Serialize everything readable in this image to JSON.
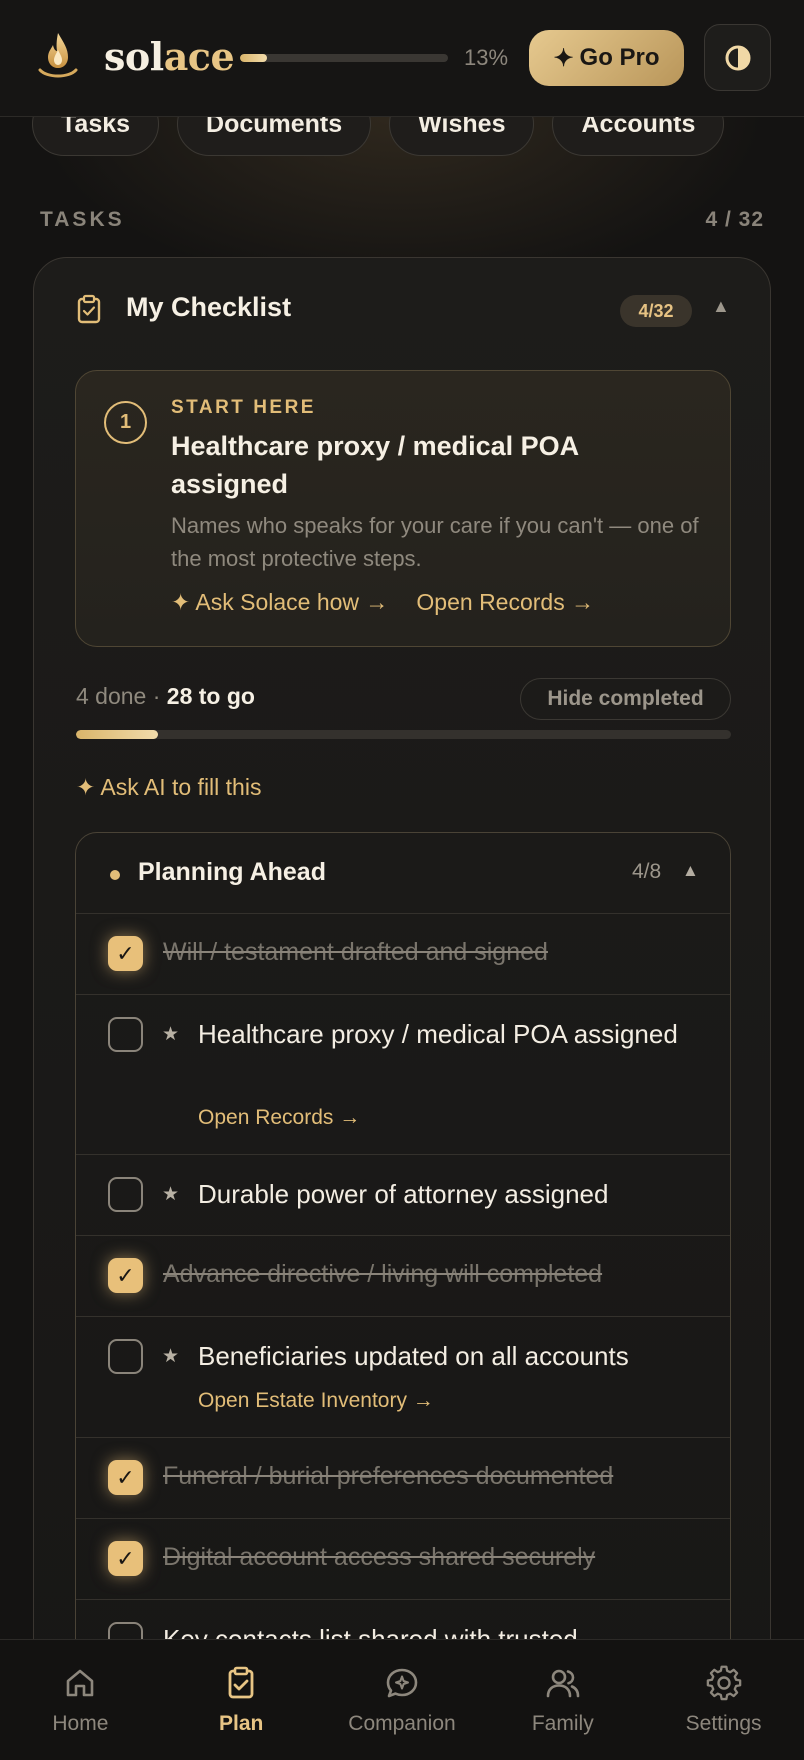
{
  "header": {
    "logo_prefix": "sol",
    "logo_accent": "ace",
    "progress_percent": 13,
    "progress_label": "13%",
    "go_pro_label": "Go Pro",
    "go_pro_icon": "sparkle-icon",
    "theme_icon": "contrast-icon"
  },
  "tabs": [
    {
      "label": "Tasks"
    },
    {
      "label": "Documents"
    },
    {
      "label": "Wishes"
    },
    {
      "label": "Accounts"
    }
  ],
  "section": {
    "label": "TASKS",
    "count": "4 / 32"
  },
  "checklist": {
    "icon": "clipboard-icon",
    "title": "My Checklist",
    "badge": "4/32",
    "start_here": {
      "number": "1",
      "kicker": "START HERE",
      "title": "Healthcare proxy / medical POA assigned",
      "description": "Names who speaks for your care if you can't — one of the most protective steps.",
      "ask_link": "✦ Ask Solace how →",
      "records_link": "Open Records →"
    },
    "progress": {
      "done_text": "4 done · ",
      "to_go_text": "28 to go",
      "done": 4,
      "total": 32
    },
    "hide_completed_label": "Hide completed",
    "ask_ai_label": "✦ Ask AI to fill this",
    "group": {
      "title": "Planning Ahead",
      "count": "4/8",
      "items": [
        {
          "text": "Will / testament drafted and signed",
          "done": true
        },
        {
          "text": "Healthcare proxy / medical POA assigned",
          "done": false,
          "starred": true,
          "link": "Open Records →"
        },
        {
          "text": "Durable power of attorney assigned",
          "done": false,
          "starred": true
        },
        {
          "text": "Advance directive / living will completed",
          "done": true
        },
        {
          "text": "Beneficiaries updated on all accounts",
          "done": false,
          "starred": true,
          "link": "Open Estate Inventory →"
        },
        {
          "text": "Funeral / burial preferences documented",
          "done": true
        },
        {
          "text": "Digital account access shared securely",
          "done": true
        },
        {
          "text": "Key contacts list shared with trusted",
          "done": false
        }
      ]
    }
  },
  "bottom_nav": [
    {
      "label": "Home",
      "icon": "home-icon",
      "active": false
    },
    {
      "label": "Plan",
      "icon": "clipboard-icon",
      "active": true
    },
    {
      "label": "Companion",
      "icon": "chat-sparkle-icon",
      "active": false
    },
    {
      "label": "Family",
      "icon": "people-icon",
      "active": false
    },
    {
      "label": "Settings",
      "icon": "gear-icon",
      "active": false
    }
  ],
  "colors": {
    "accent": "#e2bd78",
    "background": "#141312",
    "text": "#f3ede2"
  }
}
